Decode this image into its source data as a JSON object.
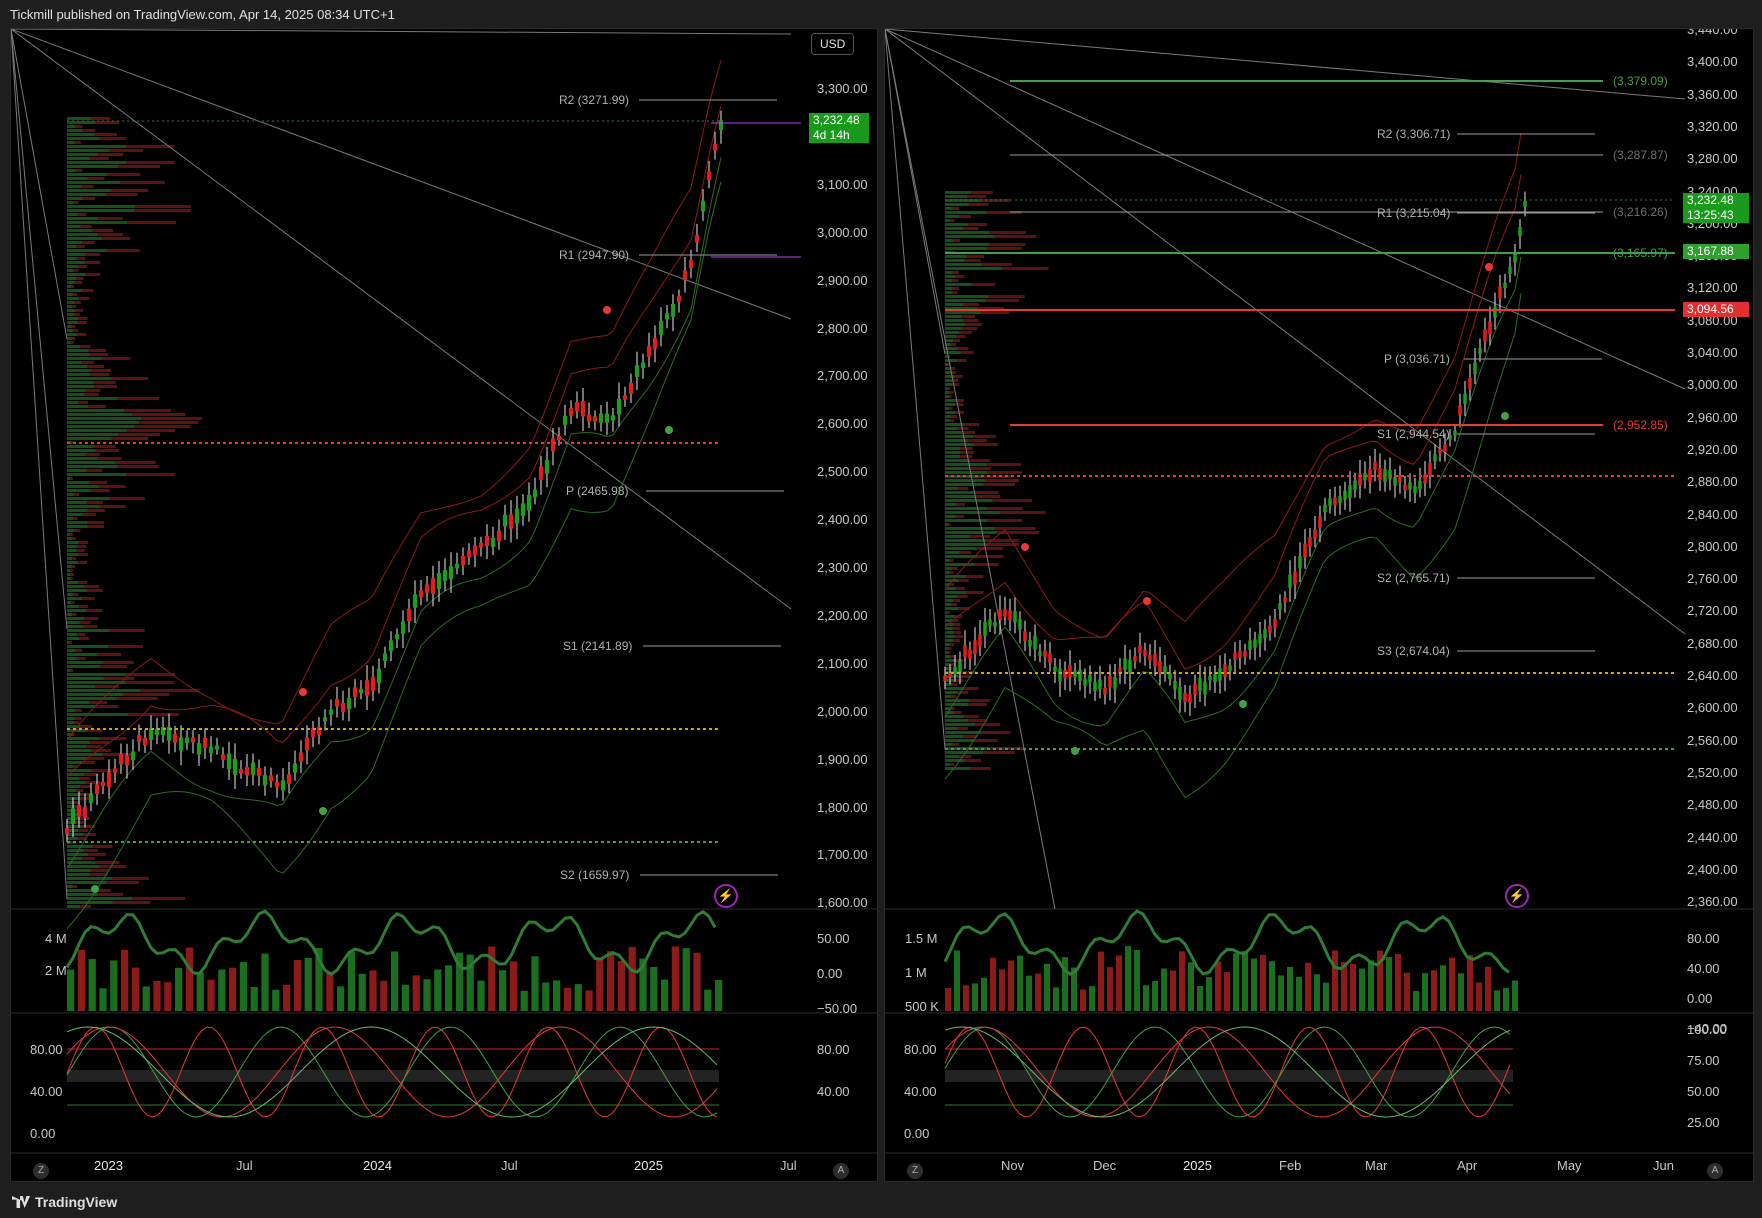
{
  "header": {
    "text": "Tickmill published on TradingView.com, Apr 14, 2025 08:34 UTC+1"
  },
  "footer": {
    "brand": "TradingView"
  },
  "colors": {
    "up": "#1e9e1e",
    "down": "#e01e1e",
    "green_line": "#3a7d2c",
    "red_line": "#8b1a1a"
  },
  "left": {
    "currency": "USD",
    "price_axis": [
      "3,300.00",
      "3,200.00",
      "3,100.00",
      "3,000.00",
      "2,900.00",
      "2,800.00",
      "2,700.00",
      "2,600.00",
      "2,500.00",
      "2,400.00",
      "2,300.00",
      "2,200.00",
      "2,100.00",
      "2,000.00",
      "1,900.00",
      "1,800.00",
      "1,700.00",
      "1,600.00"
    ],
    "last_price": "3,232.48",
    "countdown": "4d 14h",
    "levels": [
      "R2 (3271.99)",
      "R1 (2947.90)",
      "P (2465.98)",
      "S1 (2141.89)",
      "S2 (1659.97)"
    ],
    "time_axis": [
      "2023",
      "Jul",
      "2024",
      "Jul",
      "2025",
      "Jul"
    ],
    "vol_axis": [
      "4 M",
      "2 M"
    ],
    "vol_right_axis": [
      "50.00",
      "0.00",
      "−50.00"
    ],
    "osc_left_axis": [
      "80.00",
      "40.00",
      "0.00"
    ],
    "osc_right_axis": [
      "80.00",
      "40.00"
    ],
    "z_btn": "Z",
    "a_btn": "A"
  },
  "right": {
    "price_axis": [
      "3,440.00",
      "3,400.00",
      "3,360.00",
      "3,320.00",
      "3,280.00",
      "3,240.00",
      "3,200.00",
      "3,160.00",
      "3,120.00",
      "3,080.00",
      "3,040.00",
      "3,000.00",
      "2,960.00",
      "2,920.00",
      "2,880.00",
      "2,840.00",
      "2,800.00",
      "2,760.00",
      "2,720.00",
      "2,680.00",
      "2,640.00",
      "2,600.00",
      "2,560.00",
      "2,520.00",
      "2,480.00",
      "2,440.00",
      "2,400.00",
      "2,360.00"
    ],
    "last_price": "3,232.48",
    "countdown": "13:25:43",
    "tag_green": "3,167.88",
    "tag_red": "3,094.56",
    "levels": [
      "R2 (3,306.71)",
      "R1 (3,215.04)",
      "P (3,036.71)",
      "S1 (2,944.54)",
      "S2 (2,765.71)",
      "S3 (2,674.04)"
    ],
    "line_labels": [
      "(3,379.09)",
      "(3,287.87)",
      "(3,216.26)",
      "(3,165.97)",
      "(2,952.85)"
    ],
    "time_axis": [
      "Nov",
      "Dec",
      "2025",
      "Feb",
      "Mar",
      "Apr",
      "May",
      "Jun"
    ],
    "vol_axis": [
      "1.5 M",
      "1 M",
      "500 K"
    ],
    "vol_right_axis": [
      "80.00",
      "40.00",
      "0.00",
      "−40.00"
    ],
    "osc_left_axis": [
      "80.00",
      "40.00",
      "0.00"
    ],
    "osc_right_axis": [
      "100.00",
      "75.00",
      "50.00",
      "25.00"
    ],
    "z_btn": "Z",
    "a_btn": "A"
  }
}
